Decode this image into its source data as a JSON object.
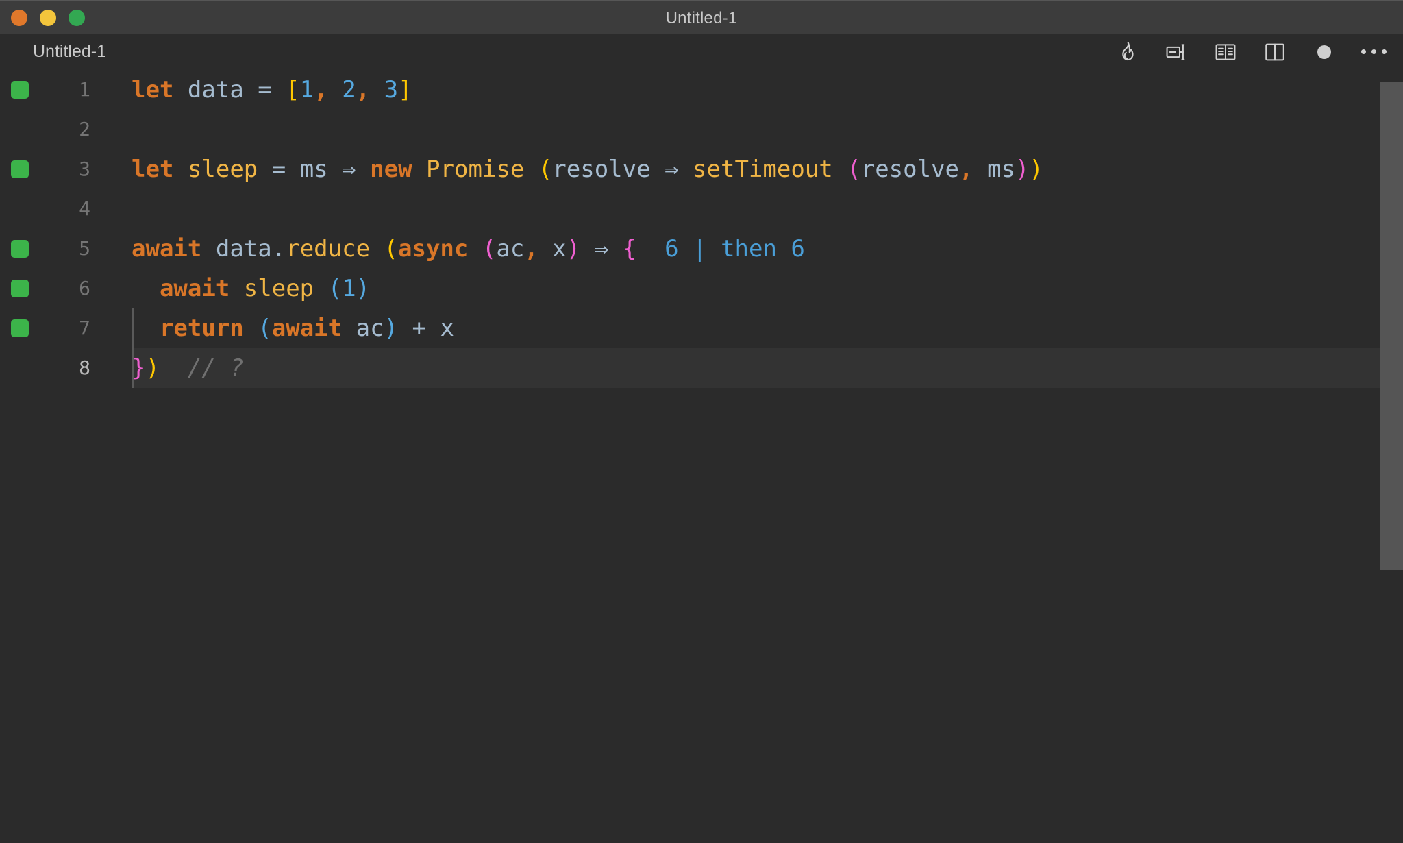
{
  "window": {
    "title": "Untitled-1",
    "traffic_lights": [
      {
        "name": "close",
        "color": "#e0782b"
      },
      {
        "name": "minimize",
        "color": "#f3c53c"
      },
      {
        "name": "zoom",
        "color": "#33a852"
      }
    ]
  },
  "tabbar": {
    "tab_label": "Untitled-1",
    "toolbar_icons": [
      {
        "name": "flame-icon",
        "label": "Quokka"
      },
      {
        "name": "rename-symbol-icon",
        "label": "Rename"
      },
      {
        "name": "open-book-icon",
        "label": "Docs"
      },
      {
        "name": "split-editor-icon",
        "label": "Split Editor"
      },
      {
        "name": "record-dot-icon",
        "label": "Record"
      },
      {
        "name": "more-actions-ellipsis-icon",
        "label": "More Actions..."
      }
    ]
  },
  "editor": {
    "language": "javascript",
    "current_line": 8,
    "colors": {
      "background": "#2b2b2b",
      "current_line": "#333333",
      "titlebar": "#3c3c3c",
      "keyword": "#d97628",
      "identifier": "#a6bcd0",
      "function": "#f0b545",
      "number": "#56a9e0",
      "bracket_level_1": "#ffc800",
      "bracket_level_2": "#ef5fd0",
      "bracket_level_3": "#56a9e0",
      "comment": "#707070",
      "gutter_marker": "#3cb44a",
      "inline_value": "#4a9fd8",
      "scrollbar": "#555555"
    },
    "lines": [
      {
        "number": "1",
        "marker": true,
        "current": false,
        "tokens": [
          {
            "t": "let",
            "c": "kw"
          },
          {
            "t": " ",
            "c": "op"
          },
          {
            "t": "data",
            "c": "id"
          },
          {
            "t": " ",
            "c": "op"
          },
          {
            "t": "=",
            "c": "op"
          },
          {
            "t": " ",
            "c": "op"
          },
          {
            "t": "[",
            "c": "b1"
          },
          {
            "t": "1",
            "c": "num"
          },
          {
            "t": ",",
            "c": "kw"
          },
          {
            "t": " ",
            "c": "op"
          },
          {
            "t": "2",
            "c": "num"
          },
          {
            "t": ",",
            "c": "kw"
          },
          {
            "t": " ",
            "c": "op"
          },
          {
            "t": "3",
            "c": "num"
          },
          {
            "t": "]",
            "c": "b1"
          }
        ]
      },
      {
        "number": "2",
        "marker": false,
        "current": false,
        "tokens": []
      },
      {
        "number": "3",
        "marker": true,
        "current": false,
        "tokens": [
          {
            "t": "let",
            "c": "kw"
          },
          {
            "t": " ",
            "c": "op"
          },
          {
            "t": "sleep",
            "c": "fn"
          },
          {
            "t": " ",
            "c": "op"
          },
          {
            "t": "=",
            "c": "op"
          },
          {
            "t": " ",
            "c": "op"
          },
          {
            "t": "ms",
            "c": "id"
          },
          {
            "t": " ",
            "c": "op"
          },
          {
            "t": "⇒",
            "c": "arrow"
          },
          {
            "t": " ",
            "c": "op"
          },
          {
            "t": "new",
            "c": "kw"
          },
          {
            "t": " ",
            "c": "op"
          },
          {
            "t": "Promise",
            "c": "fn"
          },
          {
            "t": " ",
            "c": "op"
          },
          {
            "t": "(",
            "c": "b1"
          },
          {
            "t": "resolve",
            "c": "id"
          },
          {
            "t": " ",
            "c": "op"
          },
          {
            "t": "⇒",
            "c": "arrow"
          },
          {
            "t": " ",
            "c": "op"
          },
          {
            "t": "setTimeout",
            "c": "fn"
          },
          {
            "t": " ",
            "c": "op"
          },
          {
            "t": "(",
            "c": "b2"
          },
          {
            "t": "resolve",
            "c": "id"
          },
          {
            "t": ",",
            "c": "kw"
          },
          {
            "t": " ",
            "c": "op"
          },
          {
            "t": "ms",
            "c": "id"
          },
          {
            "t": ")",
            "c": "b2"
          },
          {
            "t": ")",
            "c": "b1"
          }
        ]
      },
      {
        "number": "4",
        "marker": false,
        "current": false,
        "tokens": []
      },
      {
        "number": "5",
        "marker": true,
        "current": false,
        "tokens": [
          {
            "t": "await",
            "c": "kw"
          },
          {
            "t": " ",
            "c": "op"
          },
          {
            "t": "data",
            "c": "id"
          },
          {
            "t": ".",
            "c": "op"
          },
          {
            "t": "reduce",
            "c": "fn"
          },
          {
            "t": " ",
            "c": "op"
          },
          {
            "t": "(",
            "c": "b1"
          },
          {
            "t": "async",
            "c": "kw"
          },
          {
            "t": " ",
            "c": "op"
          },
          {
            "t": "(",
            "c": "b2"
          },
          {
            "t": "ac",
            "c": "id"
          },
          {
            "t": ",",
            "c": "kw"
          },
          {
            "t": " ",
            "c": "op"
          },
          {
            "t": "x",
            "c": "id"
          },
          {
            "t": ")",
            "c": "b2"
          },
          {
            "t": " ",
            "c": "op"
          },
          {
            "t": "⇒",
            "c": "arrow"
          },
          {
            "t": " ",
            "c": "op"
          },
          {
            "t": "{",
            "c": "b2"
          }
        ],
        "inline_value": {
          "left": "6",
          "separator": "|",
          "right": "then 6"
        }
      },
      {
        "number": "6",
        "marker": true,
        "current": false,
        "tokens": [
          {
            "t": "  ",
            "c": "op"
          },
          {
            "t": "await",
            "c": "kw"
          },
          {
            "t": " ",
            "c": "op"
          },
          {
            "t": "sleep",
            "c": "fn"
          },
          {
            "t": " ",
            "c": "op"
          },
          {
            "t": "(",
            "c": "b3"
          },
          {
            "t": "1",
            "c": "num"
          },
          {
            "t": ")",
            "c": "b3"
          }
        ]
      },
      {
        "number": "7",
        "marker": true,
        "current": false,
        "tokens": [
          {
            "t": "  ",
            "c": "op"
          },
          {
            "t": "return",
            "c": "kw"
          },
          {
            "t": " ",
            "c": "op"
          },
          {
            "t": "(",
            "c": "b3"
          },
          {
            "t": "await",
            "c": "kw"
          },
          {
            "t": " ",
            "c": "op"
          },
          {
            "t": "ac",
            "c": "id"
          },
          {
            "t": ")",
            "c": "b3"
          },
          {
            "t": " ",
            "c": "op"
          },
          {
            "t": "+",
            "c": "op"
          },
          {
            "t": " ",
            "c": "op"
          },
          {
            "t": "x",
            "c": "id"
          }
        ]
      },
      {
        "number": "8",
        "marker": false,
        "current": true,
        "tokens": [
          {
            "t": "}",
            "c": "b2"
          },
          {
            "t": ")",
            "c": "b1"
          },
          {
            "t": "  ",
            "c": "op"
          },
          {
            "t": "// ?",
            "c": "cmt"
          }
        ]
      }
    ]
  }
}
